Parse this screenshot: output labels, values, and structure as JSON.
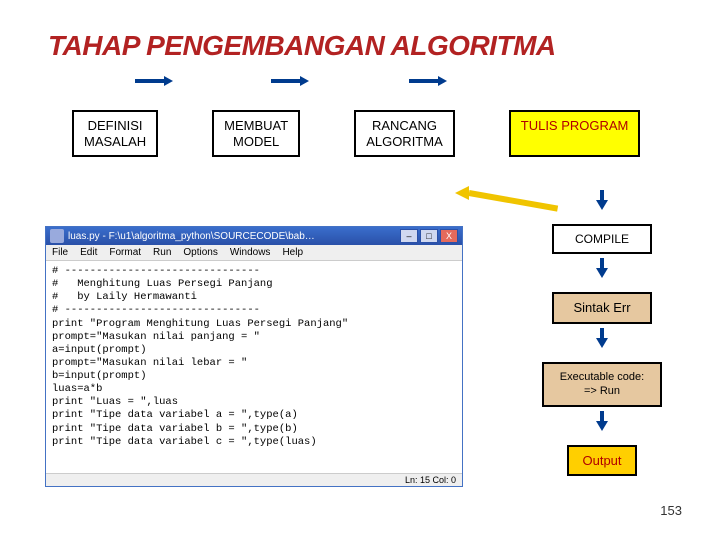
{
  "title": "TAHAP PENGEMBANGAN ALGORITMA",
  "stages": {
    "definisi": "DEFINISI\nMASALAH",
    "model": "MEMBUAT\nMODEL",
    "rancang": "RANCANG\nALGORITMA",
    "tulis": "TULIS PROGRAM",
    "compile": "COMPILE",
    "sintak": "Sintak Err",
    "exec": "Executable code:\n=> Run",
    "output": "Output"
  },
  "editor": {
    "title": "luas.py - F:\\u1\\algoritma_python\\SOURCECODE\\bab… ",
    "menus": [
      "File",
      "Edit",
      "Format",
      "Run",
      "Options",
      "Windows",
      "Help"
    ],
    "code": "# -------------------------------\n#   Menghitung Luas Persegi Panjang\n#   by Laily Hermawanti\n# -------------------------------\nprint \"Program Menghitung Luas Persegi Panjang\"\nprompt=\"Masukan nilai panjang = \"\na=input(prompt)\nprompt=\"Masukan nilai lebar = \"\nb=input(prompt)\nluas=a*b\nprint \"Luas = \",luas\nprint \"Tipe data variabel a = \",type(a)\nprint \"Tipe data variabel b = \",type(b)\nprint \"Tipe data variabel c = \",type(luas)",
    "status": "Ln: 15  Col: 0"
  },
  "page_number": "153",
  "win_buttons": {
    "min": "–",
    "max": "□",
    "close": "X"
  }
}
